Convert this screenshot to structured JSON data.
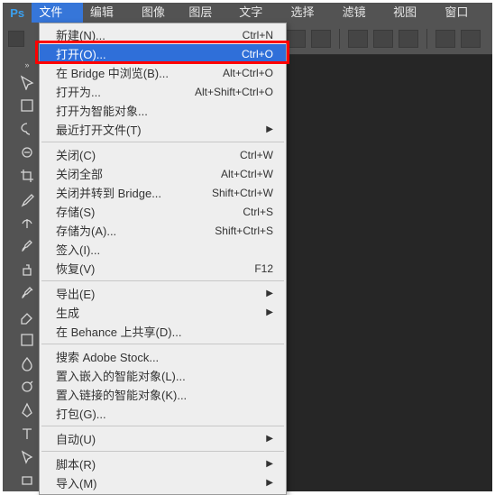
{
  "logo": "Ps",
  "menubar": [
    {
      "label": "文件(F)",
      "active": true
    },
    {
      "label": "编辑(E)"
    },
    {
      "label": "图像(I)"
    },
    {
      "label": "图层(L)"
    },
    {
      "label": "文字(Y)"
    },
    {
      "label": "选择(S)"
    },
    {
      "label": "滤镜(T)"
    },
    {
      "label": "视图(V)"
    },
    {
      "label": "窗口(W)"
    }
  ],
  "fileMenu": {
    "groups": [
      [
        {
          "label": "新建(N)...",
          "shortcut": "Ctrl+N"
        },
        {
          "label": "打开(O)...",
          "shortcut": "Ctrl+O",
          "highlight": true
        },
        {
          "label": "在 Bridge 中浏览(B)...",
          "shortcut": "Alt+Ctrl+O"
        },
        {
          "label": "打开为...",
          "shortcut": "Alt+Shift+Ctrl+O"
        },
        {
          "label": "打开为智能对象..."
        },
        {
          "label": "最近打开文件(T)",
          "submenu": true
        }
      ],
      [
        {
          "label": "关闭(C)",
          "shortcut": "Ctrl+W"
        },
        {
          "label": "关闭全部",
          "shortcut": "Alt+Ctrl+W"
        },
        {
          "label": "关闭并转到 Bridge...",
          "shortcut": "Shift+Ctrl+W"
        },
        {
          "label": "存储(S)",
          "shortcut": "Ctrl+S"
        },
        {
          "label": "存储为(A)...",
          "shortcut": "Shift+Ctrl+S"
        },
        {
          "label": "签入(I)..."
        },
        {
          "label": "恢复(V)",
          "shortcut": "F12"
        }
      ],
      [
        {
          "label": "导出(E)",
          "submenu": true
        },
        {
          "label": "生成",
          "submenu": true
        },
        {
          "label": "在 Behance 上共享(D)..."
        }
      ],
      [
        {
          "label": "搜索 Adobe Stock..."
        },
        {
          "label": "置入嵌入的智能对象(L)..."
        },
        {
          "label": "置入链接的智能对象(K)..."
        },
        {
          "label": "打包(G)..."
        }
      ],
      [
        {
          "label": "自动(U)",
          "submenu": true
        }
      ],
      [
        {
          "label": "脚本(R)",
          "submenu": true
        },
        {
          "label": "导入(M)",
          "submenu": true
        }
      ]
    ]
  },
  "tools": [
    {
      "name": "move-tool"
    },
    {
      "name": "marquee-tool"
    },
    {
      "name": "lasso-tool"
    },
    {
      "name": "quick-select-tool"
    },
    {
      "name": "crop-tool"
    },
    {
      "name": "eyedropper-tool"
    },
    {
      "name": "healing-tool"
    },
    {
      "name": "brush-tool"
    },
    {
      "name": "clone-tool"
    },
    {
      "name": "history-brush-tool"
    },
    {
      "name": "eraser-tool"
    },
    {
      "name": "gradient-tool"
    },
    {
      "name": "blur-tool"
    },
    {
      "name": "dodge-tool"
    },
    {
      "name": "pen-tool"
    },
    {
      "name": "type-tool"
    },
    {
      "name": "path-select-tool"
    },
    {
      "name": "rectangle-tool"
    }
  ]
}
